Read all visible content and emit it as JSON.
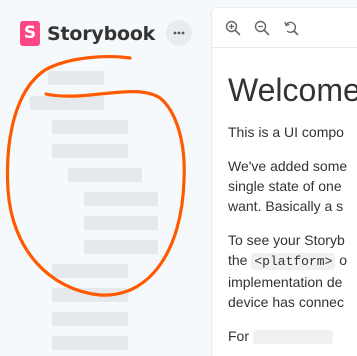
{
  "sidebar": {
    "brand_mark": "S",
    "brand_name": "Storybook",
    "menu_icon": "more-horizontal-icon"
  },
  "toolbar": {
    "icons": [
      "zoom-in-icon",
      "zoom-out-icon",
      "zoom-reset-icon"
    ]
  },
  "doc": {
    "title": "Welcome",
    "p1": "This is a UI compo",
    "p2_line1": "We've added some",
    "p2_line2": "single state of one",
    "p2_line3": "want. Basically a s",
    "p3_line1": "To see your Storyb",
    "p3_line2_pre": "the ",
    "p3_code": "<platform>",
    "p3_line2_post": " o",
    "p3_line3": "implementation de",
    "p3_line4": "device has connec",
    "p4_pre": "For "
  },
  "colors": {
    "brand": "#ff4785",
    "annotation": "#ff5a00"
  }
}
